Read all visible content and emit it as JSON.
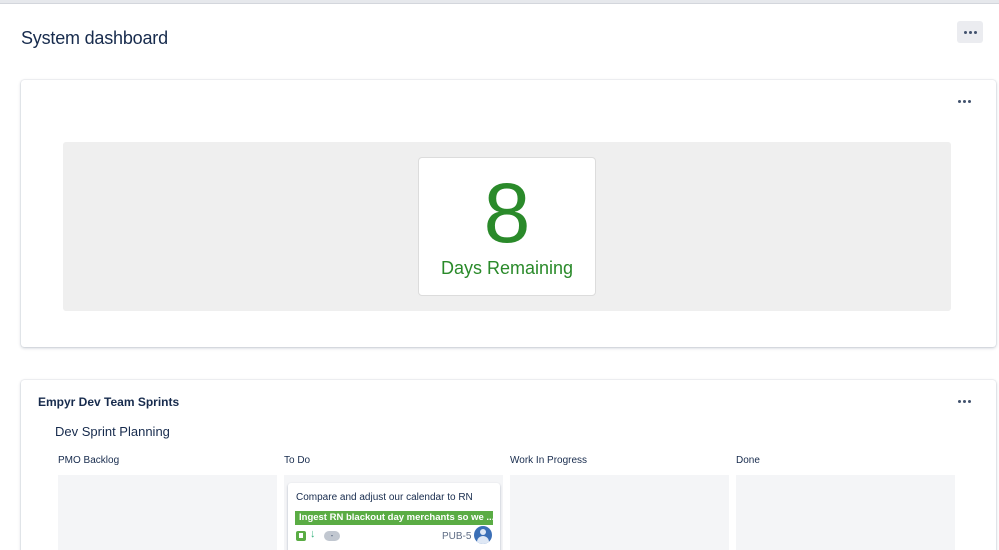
{
  "page": {
    "title": "System dashboard"
  },
  "countdown": {
    "value": "8",
    "label": "Days Remaining",
    "color": "#2a8a2a"
  },
  "sprint_gadget": {
    "title": "Empyr Dev Team Sprints",
    "board_name": "Dev Sprint Planning",
    "columns": [
      {
        "label": "PMO Backlog"
      },
      {
        "label": "To Do"
      },
      {
        "label": "Work In Progress"
      },
      {
        "label": "Done"
      }
    ],
    "card": {
      "summary": "Compare and adjust our calendar to RN",
      "epic": "Ingest RN blackout day merchants so we ...",
      "epic_color": "#5aac44",
      "type_icon": "story-icon",
      "priority_icon": "arrow-down-icon",
      "estimate": "-",
      "key": "PUB-5",
      "assignee_icon": "avatar-icon"
    }
  },
  "icons": {
    "more": "more-icon"
  }
}
